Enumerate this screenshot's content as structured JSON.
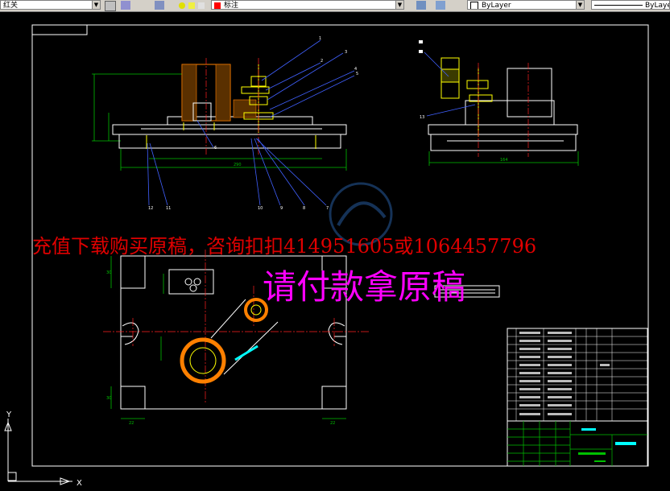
{
  "toolbar": {
    "color_value": "红关",
    "layer_name": "标注",
    "linetype_value": "ByLayer",
    "lineweight_value": "ByLaye"
  },
  "watermark": {
    "contact_line": "充值下载购买原稿，咨询扣扣414951605或1064457796",
    "pay_line": "请付款拿原稿"
  },
  "drawing": {
    "front_view": {
      "balloons": [
        "1",
        "2",
        "3",
        "4",
        "5",
        "6",
        "7",
        "8",
        "9",
        "10",
        "11",
        "12"
      ],
      "dims": [
        "290"
      ]
    },
    "side_view": {
      "balloons": [
        "13"
      ],
      "dims": [
        "164"
      ]
    },
    "plan_view": {
      "dims": [
        "22",
        "22",
        "30",
        "30"
      ]
    }
  },
  "ucs": {
    "x_label": "X",
    "y_label": "Y"
  },
  "colors": {
    "background": "#000000",
    "frame": "#ffffff",
    "dim_line": "#00c000",
    "leader": "#4060ff",
    "section": "#ff8000",
    "part": "#ffff00",
    "center": "#ff2020",
    "highlight": "#00ffff",
    "watermark_red": "#e00000",
    "watermark_magenta": "#ff00ff"
  }
}
